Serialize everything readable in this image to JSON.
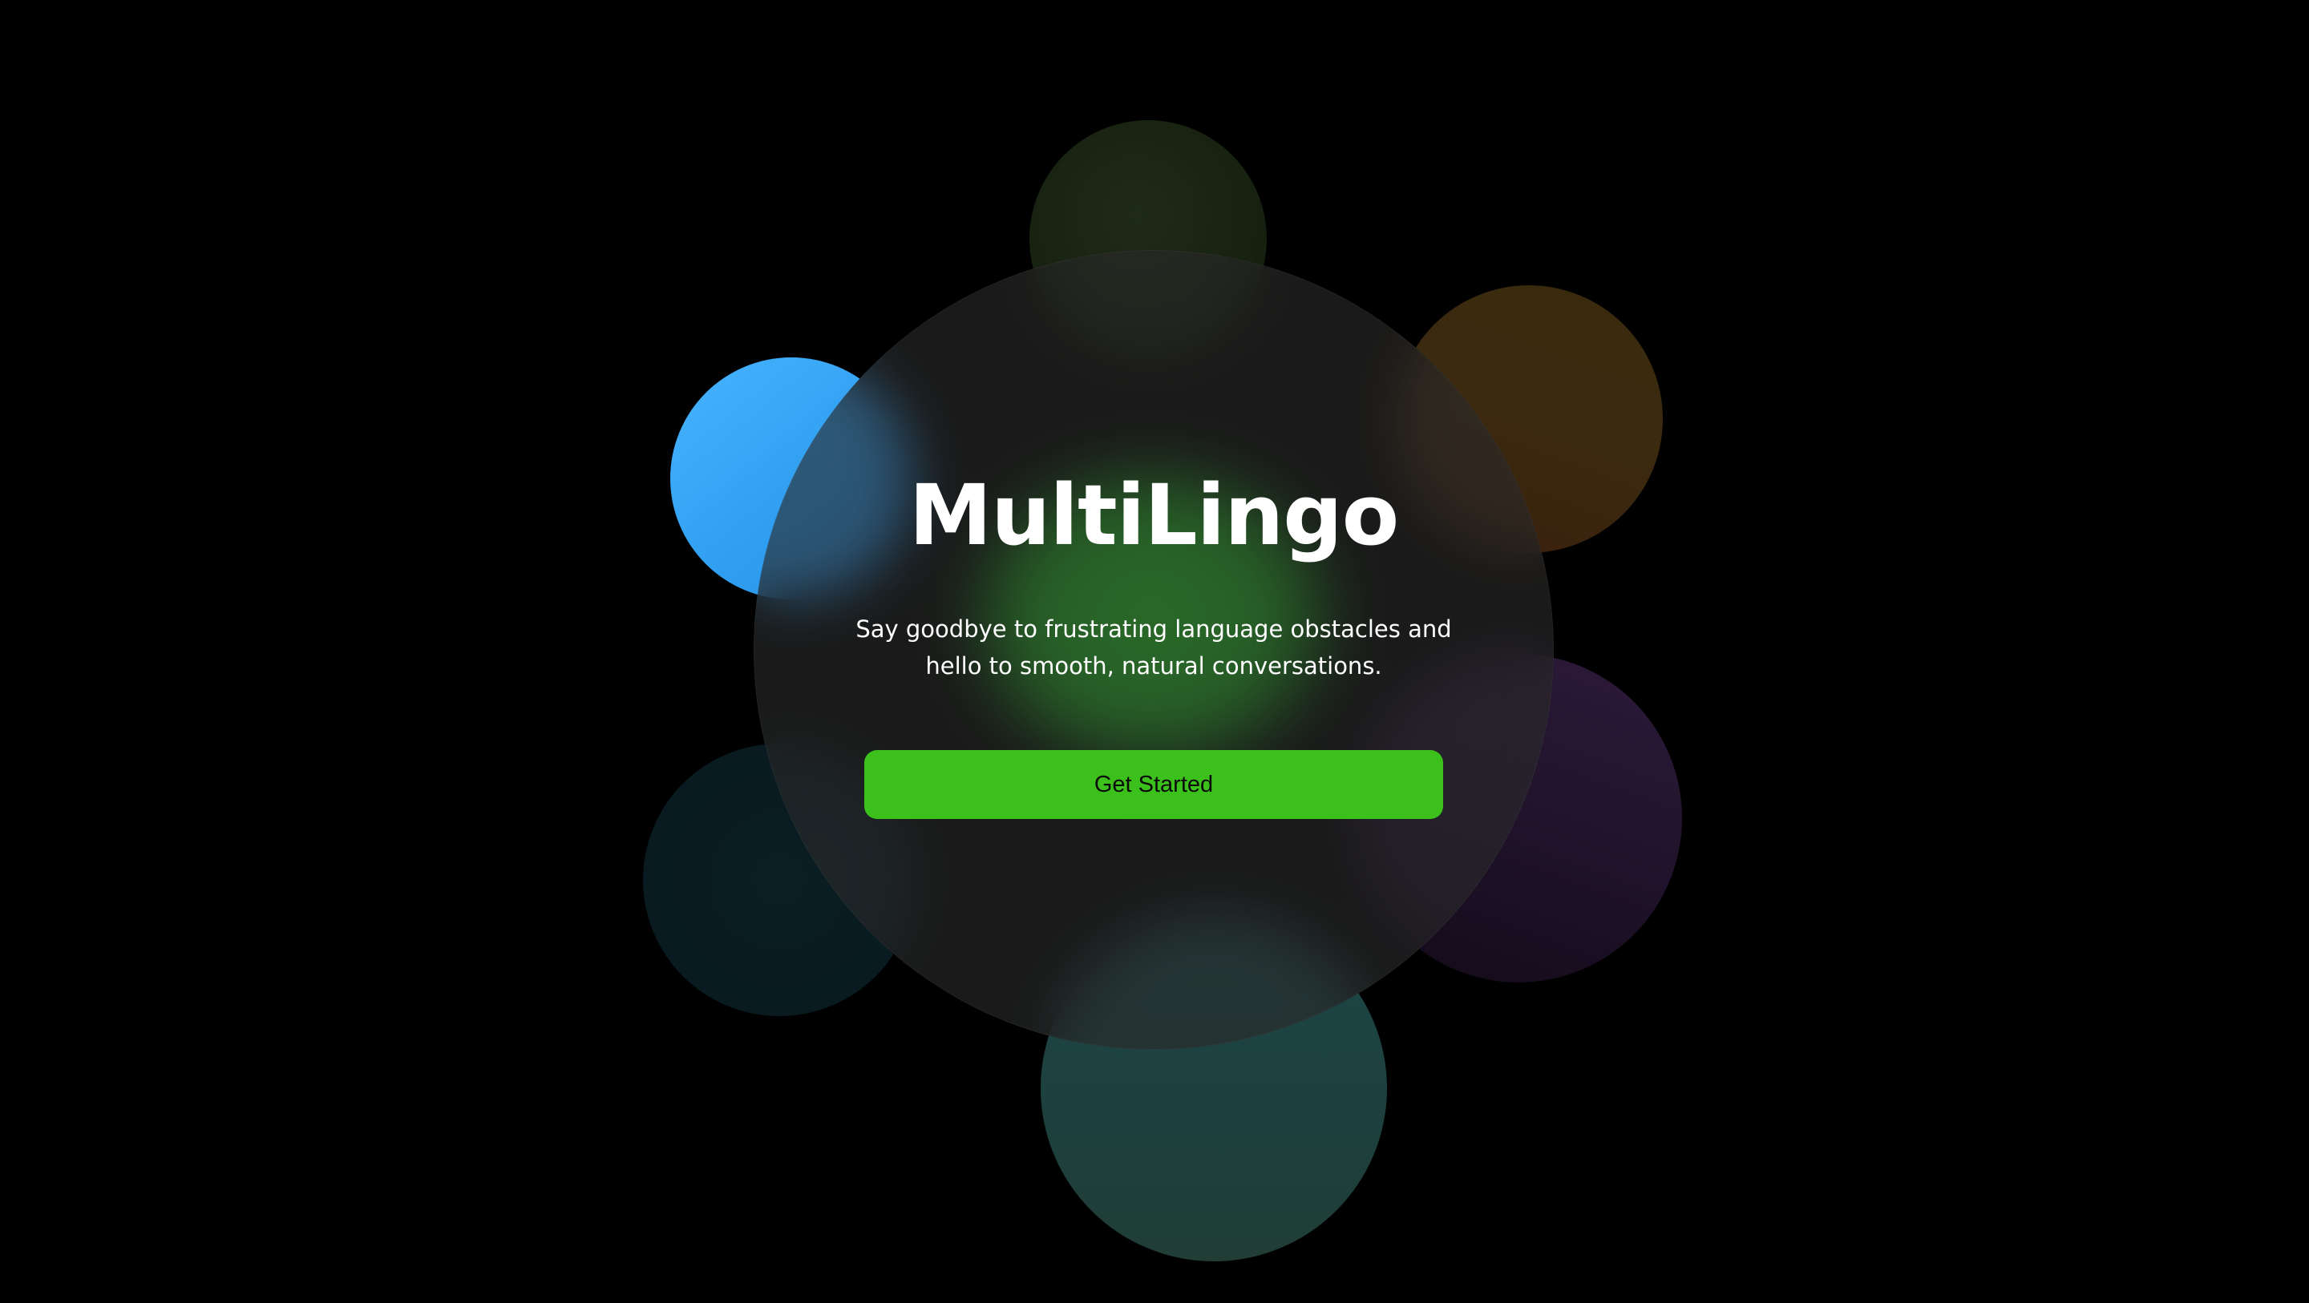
{
  "app": {
    "name": "MultiLingo"
  },
  "hero": {
    "tagline": "Say goodbye to frustrating language obstacles and hello to smooth, natural conversations.",
    "cta_label": "Get Started"
  },
  "colors": {
    "background": "#000000",
    "accent": "#3cc11c",
    "glass": "#2a2a2a",
    "orb_blue": "#3aa8f7",
    "orb_teal": "#1d4342",
    "orb_purple": "#251630",
    "orb_orange": "#3a2a0e",
    "orb_olive": "#18220f",
    "orb_navy": "#081a20",
    "glow_green": "#24b424"
  }
}
